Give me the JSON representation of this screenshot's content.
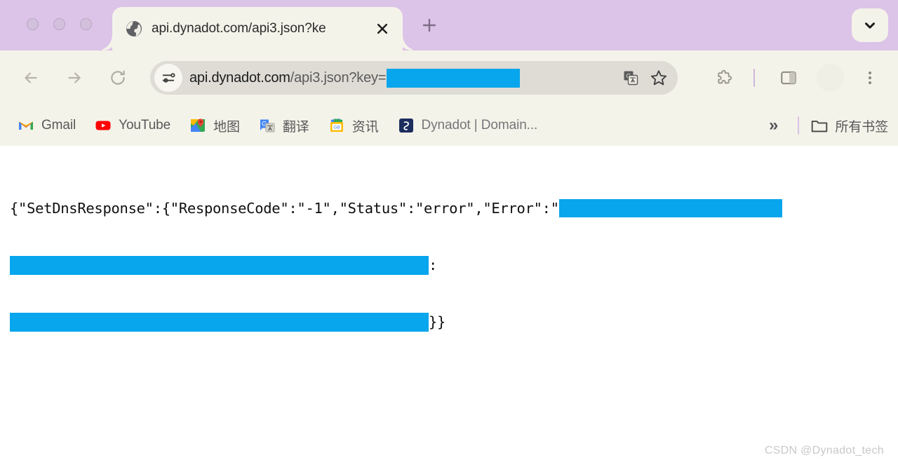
{
  "window": {
    "traffic_lights": [
      "close",
      "minimize",
      "maximize"
    ]
  },
  "tabstrip": {
    "tab": {
      "title": "api.dynadot.com/api3.json?ke",
      "favicon": "globe-icon",
      "close_label": "✕"
    },
    "new_tab_label": "+",
    "tab_search_label": "⌄"
  },
  "toolbar": {
    "back_label": "←",
    "forward_label": "→",
    "reload_label": "↻",
    "omnibox": {
      "site_info_icon": "tune-icon",
      "url_domain": "api.dynadot.com",
      "url_path": "/api3.json?key=",
      "redacted": true,
      "translate_icon": "translate-icon",
      "bookmark_icon": "star-icon"
    },
    "extensions_icon": "puzzle-icon",
    "side_panel_icon": "side-panel-icon",
    "profile_icon": "avatar-icon",
    "menu_icon": "three-dot-menu-icon"
  },
  "bookmarks": {
    "items": [
      {
        "label": "Gmail",
        "icon": "gmail-icon"
      },
      {
        "label": "YouTube",
        "icon": "youtube-icon"
      },
      {
        "label": "地图",
        "icon": "google-maps-icon"
      },
      {
        "label": "翻译",
        "icon": "google-translate-icon"
      },
      {
        "label": "资讯",
        "icon": "google-news-icon"
      },
      {
        "label": "Dynadot | Domain...",
        "icon": "dynadot-icon"
      }
    ],
    "overflow_label": "»",
    "all_bookmarks_label": "所有书签",
    "all_bookmarks_icon": "folder-icon"
  },
  "page": {
    "json_prefix": "{\"SetDnsResponse\":{\"ResponseCode\":\"-1\",\"Status\":\"error\",\"Error\":\"",
    "line2_suffix": ":",
    "line3_suffix": "}}",
    "redaction_color": "#08a6ec"
  },
  "watermark": "CSDN @Dynadot_tech"
}
